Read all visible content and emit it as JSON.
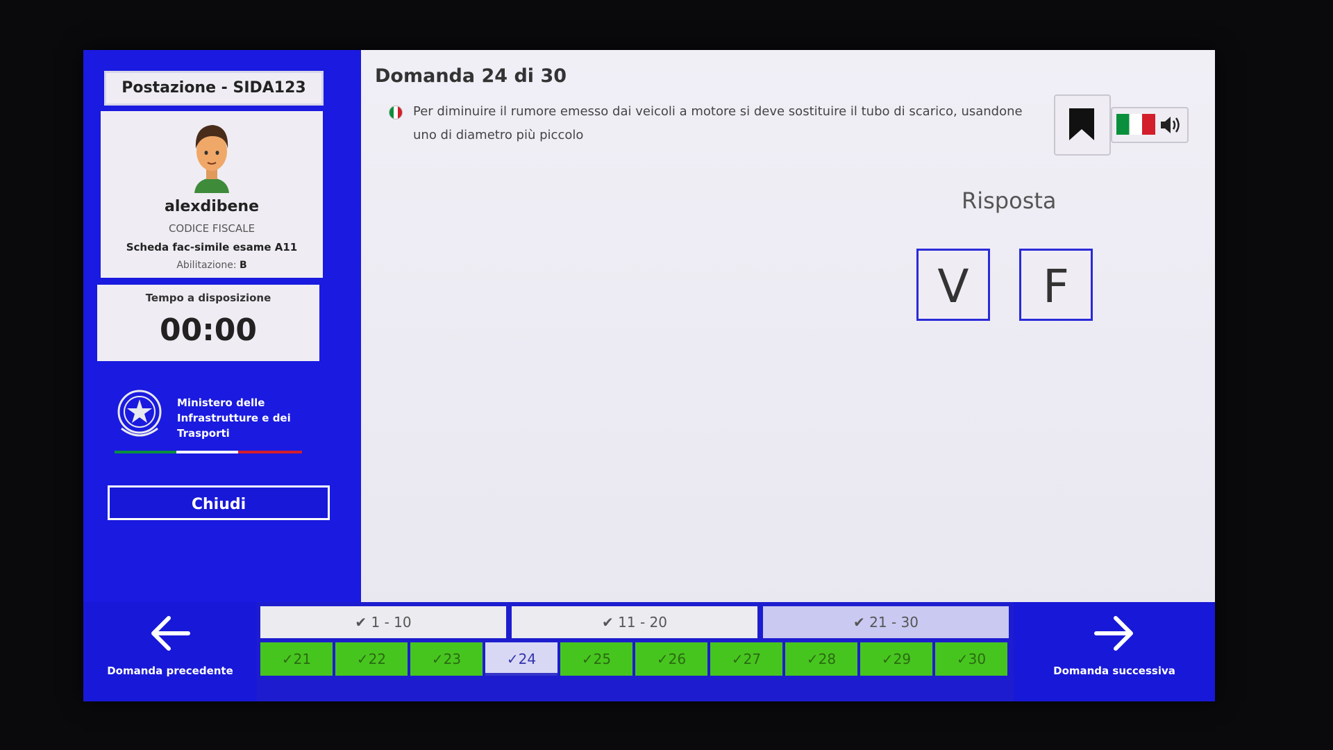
{
  "sidebar": {
    "station": "Postazione - SIDA123",
    "username": "alexdibene",
    "fiscal_code_label": "CODICE FISCALE",
    "exam_label": "Scheda fac-simile esame A11",
    "license_label": "Abilitazione:",
    "license_value": "B",
    "timer_label": "Tempo a disposizione",
    "timer_value": "00:00",
    "ministry_name": "Ministero delle Infrastrutture e dei Trasporti",
    "close_label": "Chiudi"
  },
  "question": {
    "title": "Domanda 24 di 30",
    "text": "Per diminuire il rumore emesso dai veicoli a motore si deve sostituire il tubo di scarico, usandone uno di diametro più piccolo",
    "answer_label": "Risposta",
    "true_label": "V",
    "false_label": "F",
    "icons": {
      "bookmark": "bookmark-icon",
      "audio": "speaker-icon",
      "language": "italian-flag-icon"
    }
  },
  "nav": {
    "prev_label": "Domanda precedente",
    "next_label": "Domanda successiva",
    "ranges": [
      "1 - 10",
      "11 - 20",
      "21 - 30"
    ],
    "active_range": 2,
    "questions": [
      "21",
      "22",
      "23",
      "24",
      "25",
      "26",
      "27",
      "28",
      "29",
      "30"
    ],
    "current": "24"
  },
  "colors": {
    "primary_blue": "#1a1ae0",
    "answered_green": "#47c51f",
    "active_range": "#c9c9f2"
  }
}
